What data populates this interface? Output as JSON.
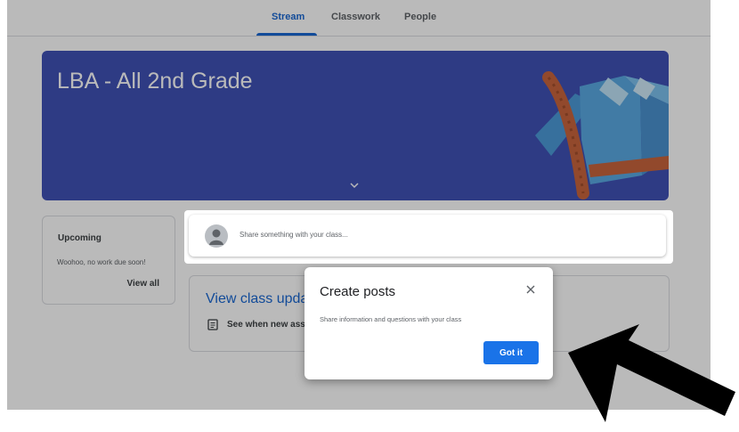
{
  "tabs": [
    {
      "label": "Stream",
      "active": true
    },
    {
      "label": "Classwork",
      "active": false
    },
    {
      "label": "People",
      "active": false
    }
  ],
  "banner": {
    "title": "LBA - All 2nd Grade",
    "color": "#3f51b5"
  },
  "upcoming": {
    "title": "Upcoming",
    "text": "Woohoo, no work due soon!",
    "link": "View all"
  },
  "share": {
    "placeholder": "Share something with your class..."
  },
  "updates": {
    "heading": "View class upda",
    "subtext": "See when new assi"
  },
  "dialog": {
    "title": "Create posts",
    "text": "Share information and questions with your class",
    "button": "Got it"
  },
  "colors": {
    "accent": "#1967d2",
    "button": "#1a73e8",
    "arrow": "#000000"
  },
  "icons": [
    "chevron-down-icon",
    "close-icon",
    "assignment-icon",
    "avatar-icon",
    "arrow-icon"
  ]
}
